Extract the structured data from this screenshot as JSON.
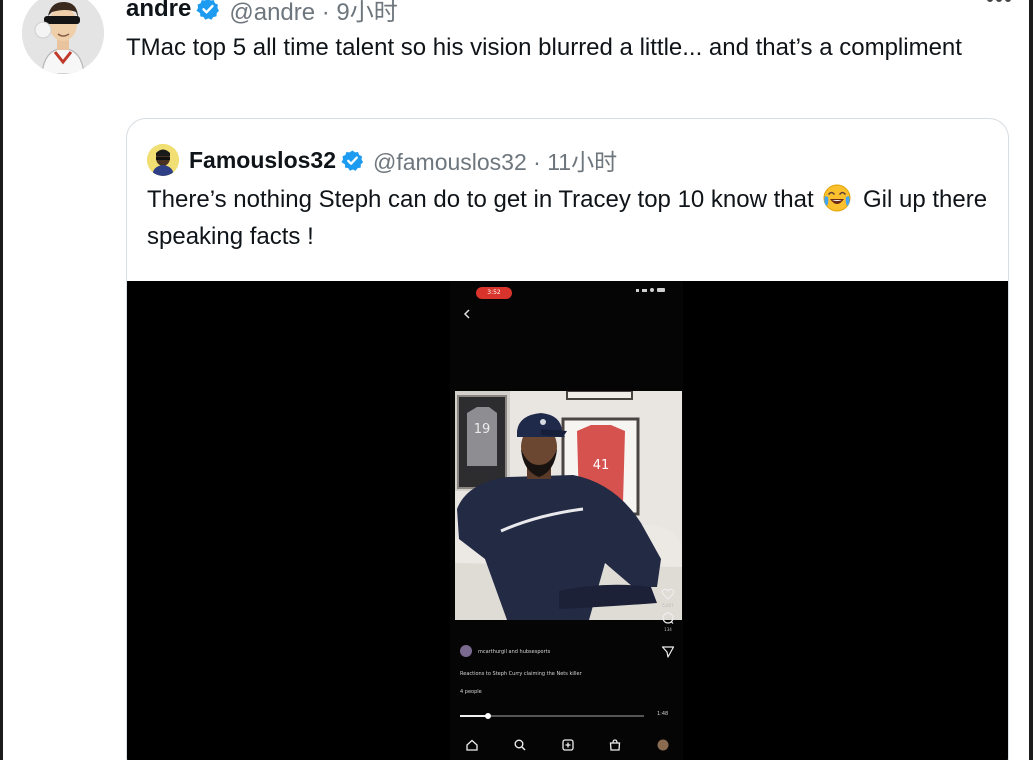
{
  "tweet": {
    "author_name": "andre",
    "handle_time": "@andre · 9小时",
    "text": "TMac top 5 all time talent so his vision blurred a little... and that’s a compliment"
  },
  "quoted_tweet": {
    "author_name": "Famouslos32",
    "handle_time": "@famouslos32 · 11小时",
    "text_before_emoji": "There’s nothing Steph can do to get in Tracey top 10 know that",
    "emoji": "face-with-tears-of-joy",
    "text_after_emoji": "Gil up there speaking facts !"
  },
  "embedded_video": {
    "status_time": "3:52",
    "jersey_left": "19",
    "jersey_right": "41",
    "like_count": "5,657",
    "comment_count": "134",
    "caption_accounts": "mcarthurgil and hubsesports",
    "caption_text": "Reactions to Steph Curry claiming the Nets killer",
    "caption_people": "4 people",
    "progress_fraction": 0.15,
    "duration": "1:48"
  },
  "colors": {
    "verified_blue": "#1d9bf0",
    "text_primary": "#0f1419",
    "text_secondary": "#6e767d",
    "quote_border": "#d7dde2",
    "video_bg": "#000000",
    "recording_badge": "#d9342b"
  },
  "icons": [
    "verified-badge-icon",
    "more-options-icon",
    "laughing-emoji-icon",
    "back-arrow-icon",
    "heart-icon",
    "comment-icon",
    "share-icon",
    "home-icon",
    "search-icon",
    "create-icon",
    "shop-icon",
    "profile-icon"
  ]
}
